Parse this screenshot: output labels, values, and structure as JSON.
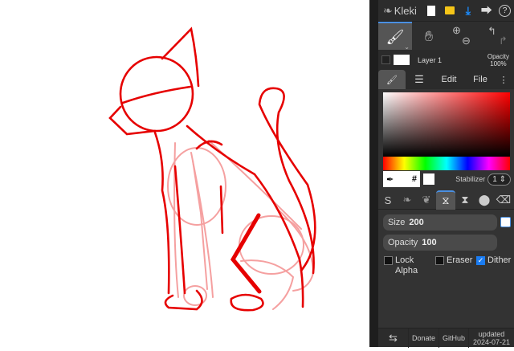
{
  "app": {
    "name": "Kleki"
  },
  "topbar": {
    "icons": [
      "new-image-icon",
      "open-folder-icon",
      "download-icon",
      "share-icon",
      "help-icon"
    ]
  },
  "tools": {
    "items": [
      "brush-tool",
      "hand-tool",
      "zoom-in",
      "zoom-out",
      "undo",
      "redo"
    ]
  },
  "layer": {
    "name": "Layer 1",
    "opacity_label": "Opacity",
    "opacity_value": "100%"
  },
  "tabs": {
    "edit": "Edit",
    "file": "File"
  },
  "color": {
    "hash": "#",
    "current": "#ffffff",
    "stabilizer_label": "Stabilizer",
    "stabilizer_value": "1"
  },
  "brush": {
    "size_label": "Size",
    "size_value": "200",
    "opacity_label": "Opacity",
    "opacity_value": "100"
  },
  "options": {
    "lock_alpha": "Lock Alpha",
    "eraser": "Eraser",
    "dither": "Dither",
    "dither_checked": true
  },
  "footer": {
    "donate": "Donate",
    "github": "GitHub",
    "updated_label": "updated",
    "updated_date": "2024-07-21"
  },
  "colors": {
    "accent": "#4a90e2",
    "stroke": "#e60000",
    "stroke_light": "#f59a9a"
  }
}
